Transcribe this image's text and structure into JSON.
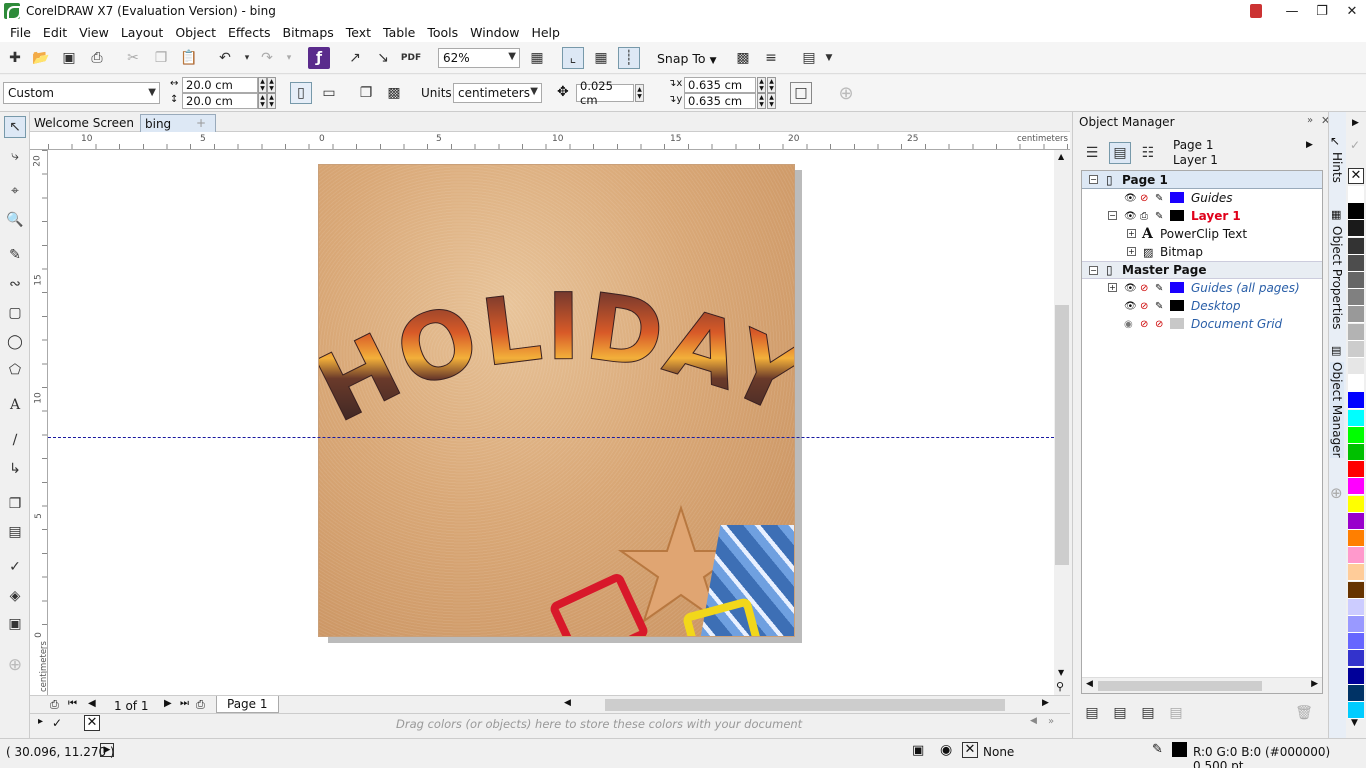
{
  "window": {
    "title": "CorelDRAW X7 (Evaluation Version) - bing"
  },
  "menu": [
    "File",
    "Edit",
    "View",
    "Layout",
    "Object",
    "Effects",
    "Bitmaps",
    "Text",
    "Table",
    "Tools",
    "Window",
    "Help"
  ],
  "toolbar": {
    "zoom": "62%",
    "snap_to": "Snap To"
  },
  "propbar": {
    "preset": "Custom",
    "width": "20.0 cm",
    "height": "20.0 cm",
    "units_label": "Units:",
    "units": "centimeters",
    "nudge": "0.025 cm",
    "dup_x": "0.635 cm",
    "dup_y": "0.635 cm"
  },
  "tabs": {
    "welcome": "Welcome Screen",
    "doc": "bing"
  },
  "ruler": {
    "unit": "centimeters",
    "h_ticks": [
      "10",
      "5",
      "0",
      "5",
      "10",
      "15",
      "20",
      "25"
    ],
    "v_ticks": [
      "20",
      "15",
      "10",
      "5",
      "0"
    ],
    "v_unit": "centimeters"
  },
  "artwork": {
    "headline": "HOLIDAY"
  },
  "page_nav": {
    "count": "1 of 1",
    "page_tab": "Page 1"
  },
  "palette_hint": "Drag colors (or objects) here to store these colors with your document",
  "object_manager": {
    "title": "Object Manager",
    "current_page": "Page 1",
    "current_layer": "Layer 1",
    "tree": {
      "page1": "Page 1",
      "guides": "Guides",
      "layer1": "Layer 1",
      "powerclip": "PowerClip Text",
      "bitmap": "Bitmap",
      "master": "Master Page",
      "guides_all": "Guides (all pages)",
      "desktop": "Desktop",
      "docgrid": "Document Grid"
    }
  },
  "docker_tabs": {
    "hints": "Hints",
    "props": "Object Properties",
    "mgr": "Object Manager"
  },
  "status": {
    "coords": "( 30.096, 11.270 )",
    "fill": "None",
    "outline": "R:0 G:0 B:0 (#000000)  0.500 pt"
  },
  "colors": {
    "guide_blue": "#1a00ff",
    "layer_red": "#e0001a",
    "palette": [
      "#ffffff",
      "#000000",
      "#1a1a1a",
      "#333333",
      "#4d4d4d",
      "#666666",
      "#808080",
      "#999999",
      "#b3b3b3",
      "#cccccc",
      "#e6e6e6",
      "#ffffff",
      "#0000ff",
      "#00ffff",
      "#00ff00",
      "#00c000",
      "#ff0000",
      "#ff00ff",
      "#ffff00",
      "#9900cc",
      "#ff7f00",
      "#ff99cc",
      "#ffcc99",
      "#663300",
      "#ccccff",
      "#9999ff",
      "#6666ff",
      "#3333cc",
      "#000099",
      "#003366",
      "#00ccff"
    ]
  }
}
